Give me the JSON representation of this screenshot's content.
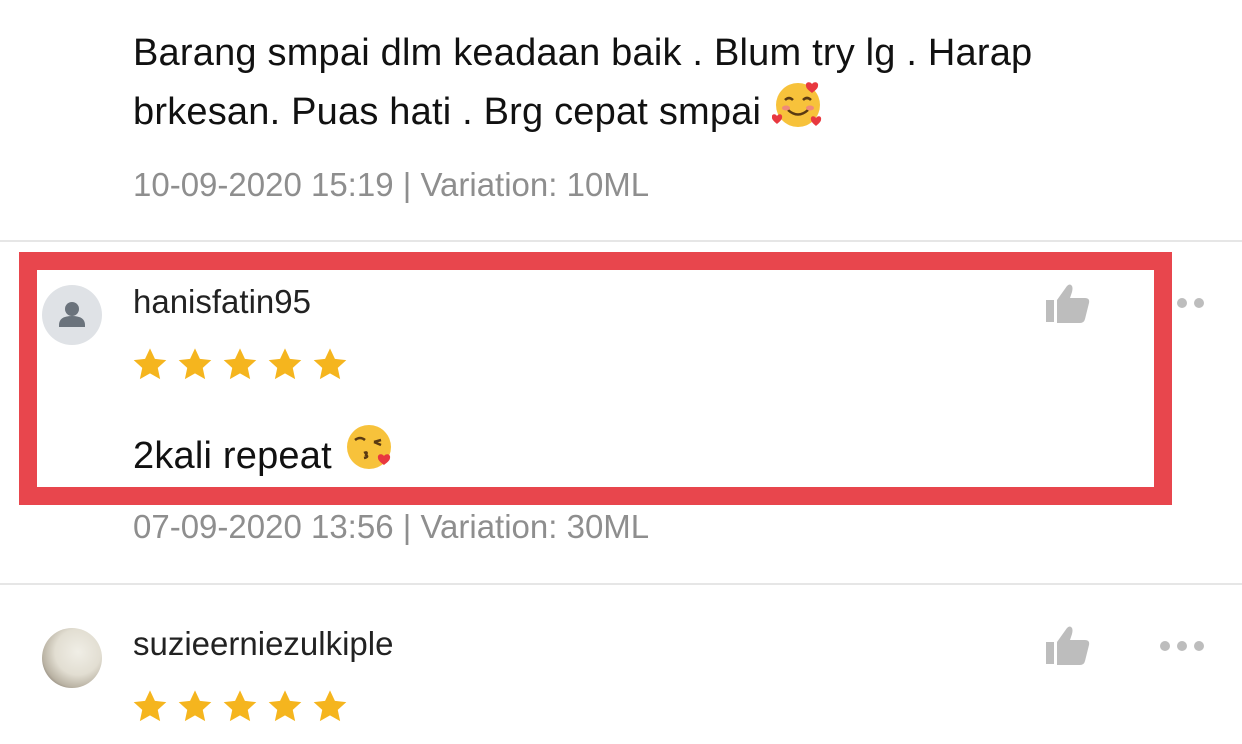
{
  "reviews": [
    {
      "text": "Barang smpai dlm keadaan baik . Blum try lg . Harap brkesan.  Puas hati . Brg cepat smpai",
      "emoji": "smiling-face-with-hearts",
      "meta": "10-09-2020 15:19 | Variation: 10ML"
    },
    {
      "username": "hanisfatin95",
      "rating": 5,
      "text": "2kali repeat",
      "emoji": "face-blowing-kiss",
      "meta": "07-09-2020 13:56 | Variation: 30ML",
      "highlighted": true
    },
    {
      "username": "suzieerniezulkiple",
      "rating": 5
    }
  ],
  "colors": {
    "highlight_border": "#e8464d",
    "star": "#f5b51e",
    "meta_text": "#8e8e8e",
    "icon_grey": "#bdbdbd"
  },
  "icons": {
    "like": "thumbs-up-icon",
    "more": "more-dots-icon",
    "avatar_default": "user-silhouette-icon"
  }
}
